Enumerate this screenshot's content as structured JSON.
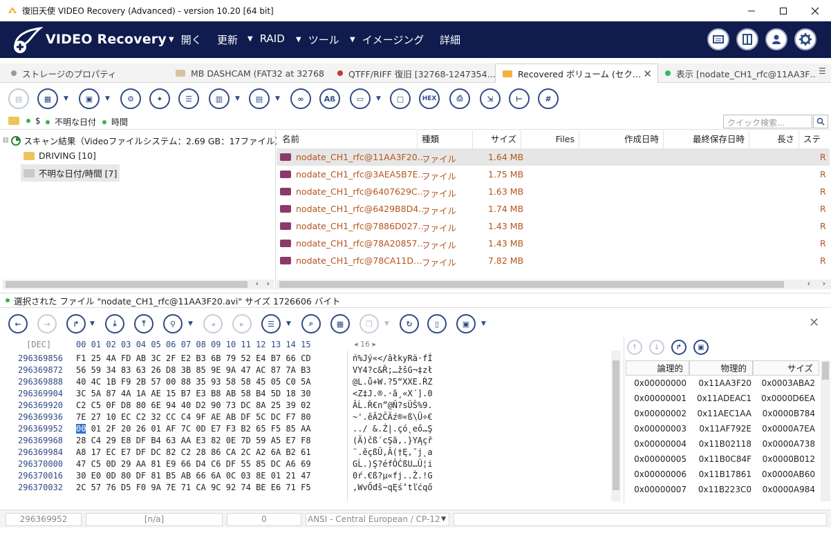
{
  "window": {
    "title": "復旧天使 VIDEO Recovery (Advanced) - version 10.20 [64 bit]"
  },
  "header": {
    "brand": "VIDEO Recovery",
    "menu": [
      "開く",
      "更新",
      "RAID",
      "ツール",
      "イメージング",
      "詳細"
    ]
  },
  "tabs": [
    {
      "label": "ストレージのプロパティ",
      "marker": "gray-dot"
    },
    {
      "label": "MB DASHCAM (FAT32 at 32768 …",
      "marker": "folder"
    },
    {
      "label": "QTFF/RIFF 復旧 [32768-1247354…",
      "marker": "red-dot"
    },
    {
      "label": "Recovered ボリューム (セク…",
      "marker": "folder",
      "active": true
    },
    {
      "label": "表示 [nodate_CH1_rfc@11AA3F…",
      "marker": "green-dot"
    }
  ],
  "pathbar": {
    "crumbs": [
      "$",
      "不明な日付",
      "時間"
    ],
    "search_placeholder": "クイック検索..."
  },
  "tree": {
    "root": "スキャン結果（Videoファイルシステム：2.69 GB：17ファイル）",
    "children": [
      "DRIVING [10]",
      "不明な日付/時間 [7]"
    ]
  },
  "list": {
    "columns": [
      "名前",
      "種類",
      "サイズ",
      "Files",
      "作成日時",
      "最終保存日時",
      "長さ",
      "ステー"
    ],
    "rows": [
      {
        "name": "nodate_CH1_rfc@11AA3F20…",
        "type": "ファイル",
        "size": "1.64 MB",
        "state": "R"
      },
      {
        "name": "nodate_CH1_rfc@3AEA5B7E…",
        "type": "ファイル",
        "size": "1.75 MB",
        "state": "R"
      },
      {
        "name": "nodate_CH1_rfc@6407629C…",
        "type": "ファイル",
        "size": "1.63 MB",
        "state": "R"
      },
      {
        "name": "nodate_CH1_rfc@6429B8D4…",
        "type": "ファイル",
        "size": "1.74 MB",
        "state": "R"
      },
      {
        "name": "nodate_CH1_rfc@7886D027…",
        "type": "ファイル",
        "size": "1.43 MB",
        "state": "R"
      },
      {
        "name": "nodate_CH1_rfc@78A20857…",
        "type": "ファイル",
        "size": "1.43 MB",
        "state": "R"
      },
      {
        "name": "nodate_CH1_rfc@78CA11D…",
        "type": "ファイル",
        "size": "7.82 MB",
        "state": "R"
      }
    ]
  },
  "status": {
    "selected": "選択された ファイル \"nodate_CH1_rfc@11AA3F20.avi\" サイズ 1726606 バイト"
  },
  "hex": {
    "base": "[DEC]",
    "col_header": "00 01 02 03 04 05 06 07 08 09 10 11 12 13 14 15",
    "text_header": "◂ 16 ▸",
    "rows": [
      {
        "addr": "296369856",
        "pre": "",
        "sel": "",
        "post": "F1 25 4A FD AB 3C 2F E2 B3 6B 79 52 E4 B7 66 CD",
        "text": "ń%Jý«</âłkyRä·fÍ"
      },
      {
        "addr": "296369872",
        "pre": "",
        "sel": "",
        "post": "56 59 34 83 63 26 D8 3B 85 9E 9A 47 AC 87 7A B3",
        "text": "VY4?c&Ř;…žšG¬‡zł"
      },
      {
        "addr": "296369888",
        "pre": "",
        "sel": "",
        "post": "40 4C 1B F9 2B 57 00 88 35 93 58 58 45 05 C0 5A",
        "text": "@L.ů+W.?5“XXE.ŔZ"
      },
      {
        "addr": "296369904",
        "pre": "",
        "sel": "",
        "post": "3C 5A 87 4A 1A AE 15 B7 E3 B8 AB 58 B4 5D 18 30",
        "text": "<Z‡J.®.·ă¸«X´].0"
      },
      {
        "addr": "296369920",
        "pre": "",
        "sel": "",
        "post": "C2 C5 0F D8 80 6E 94 40 D2 90 73 DC 8A 25 39 02",
        "text": "ÂĹ.Ř€n”@Ň?sÜŠ%9."
      },
      {
        "addr": "296369936",
        "pre": "",
        "sel": "",
        "post": "7E 27 10 EC C2 32 CC C4 9F AE AB DF 5C DC F7 80",
        "text": "~'.ěÂ2ČÄź®«ß\\Ü÷€"
      },
      {
        "addr": "296369952",
        "pre": "",
        "sel": "00",
        "post": " 01 2F 20 26 01 AF 7C 0D E7 F3 B2 65 F5 85 AA",
        "text": "../ &.Ż|.çó˛eő…Ş"
      },
      {
        "addr": "296369968",
        "pre": "",
        "sel": "",
        "post": "28 C4 29 E8 DF B4 63 AA E3 82 0E 7D 59 A5 E7 F8",
        "text": "(Ä)čß´cŞă‚.}YĄçř"
      },
      {
        "addr": "296369984",
        "pre": "",
        "sel": "",
        "post": "A8 17 EC E7 DF DC 82 C2 28 86 CA 2C A2 6A B2 61",
        "text": "¨.ěçßÜ‚Â(†Ę,˘j˛a"
      },
      {
        "addr": "296370000",
        "pre": "",
        "sel": "",
        "post": "47 C5 0D 29 AA 81 E9 66 D4 C6 DF 55 85 DC A6 69",
        "text": "GĹ.)Ş?éfÔĆßU…Ü¦i"
      },
      {
        "addr": "296370016",
        "pre": "",
        "sel": "",
        "post": "30 E0 0D 80 DF 81 B5 AB 66 6A 0C 03 8E 01 21 47",
        "text": "0ŕ.€ß?µ«fj..Ž.!G"
      },
      {
        "addr": "296370032",
        "pre": "",
        "sel": "",
        "post": "2C 57 76 D5 F0 9A 7E 71 CA 9C 92 74 BE E6 71 F5",
        "text": ",WvŐđš~qĘś’tľćqő"
      }
    ]
  },
  "offsets": {
    "columns": [
      "論理的",
      "物理的",
      "サイズ"
    ],
    "rows": [
      [
        "0x00000000",
        "0x11AA3F20",
        "0x0003ABA2"
      ],
      [
        "0x00000001",
        "0x11ADEAC1",
        "0x0000D6EA"
      ],
      [
        "0x00000002",
        "0x11AEC1AA",
        "0x0000B784"
      ],
      [
        "0x00000003",
        "0x11AF792E",
        "0x0000A7EA"
      ],
      [
        "0x00000004",
        "0x11B02118",
        "0x0000A738"
      ],
      [
        "0x00000005",
        "0x11B0C84F",
        "0x0000B012"
      ],
      [
        "0x00000006",
        "0x11B17861",
        "0x0000AB60"
      ],
      [
        "0x00000007",
        "0x11B223C0",
        "0x0000A984"
      ]
    ]
  },
  "statusbar": {
    "offset": "296369952",
    "na": "[n/a]",
    "value": "0",
    "encoding": "ANSI - Central European / CP-12"
  },
  "colors": {
    "header_bg": "#0f1c4d",
    "accent": "#2e4a86",
    "file_text": "#b5541c"
  }
}
